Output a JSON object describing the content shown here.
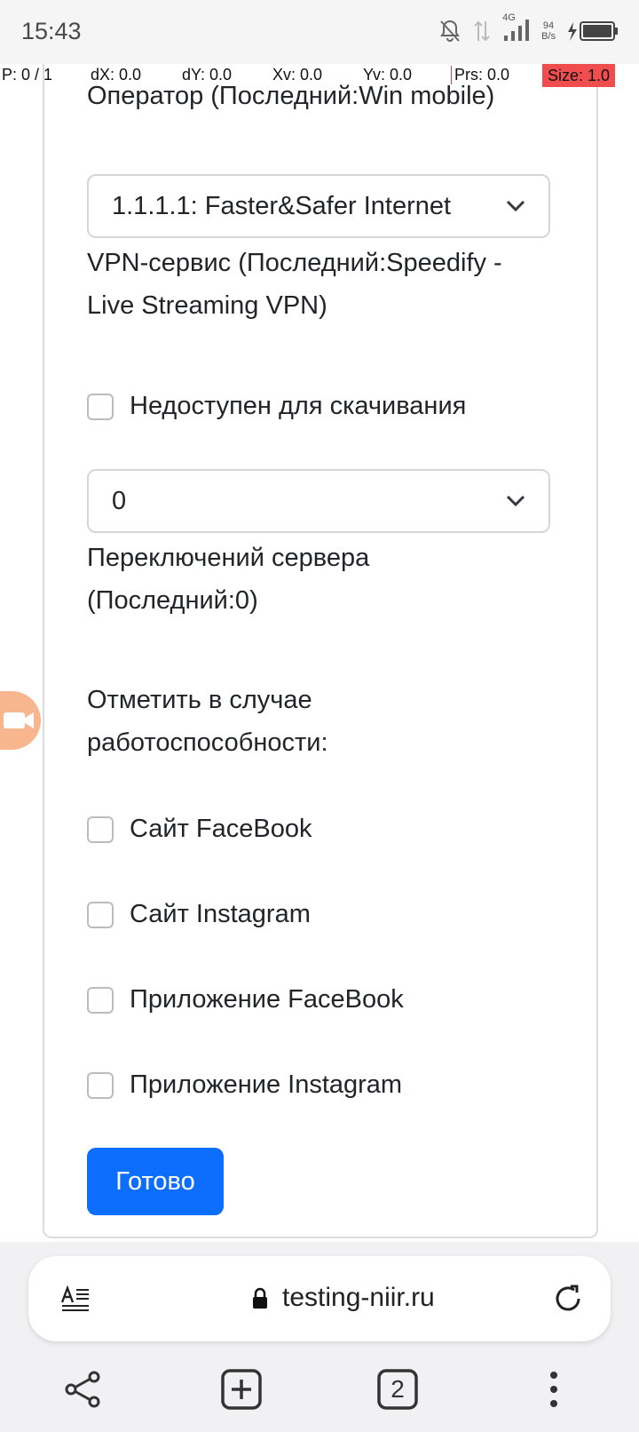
{
  "status_bar": {
    "time": "15:43",
    "network": "4G",
    "speed_value": "94",
    "speed_unit": "B/s"
  },
  "overlay": {
    "pointer": "P: 0 / 1",
    "dx": "dX: 0.0",
    "dy": "dY: 0.0",
    "xv": "Xv: 0.0",
    "yv": "Yv: 0.0",
    "prs": "Prs: 0.0",
    "size": "Size: 1.0"
  },
  "form": {
    "operator_label": "Оператор (Последний:Win mobile)",
    "vpn_select_value": "1.1.1.1: Faster&Safer Internet",
    "vpn_label_line1": "VPN-сервис (Последний:Speedify -",
    "vpn_label_line2": "Live Streaming VPN)",
    "unavailable_label": "Недоступен для скачивания",
    "switch_select_value": "0",
    "switch_label_line1": "Переключений сервера",
    "switch_label_line2": "(Последний:0)",
    "mark_label_line1": "Отметить в случае",
    "mark_label_line2": "работоспособности:",
    "checks": [
      {
        "label": "Сайт FaceBook"
      },
      {
        "label": "Сайт Instagram"
      },
      {
        "label": "Приложение FaceBook"
      },
      {
        "label": "Приложение Instagram"
      }
    ],
    "submit_label": "Готово"
  },
  "browser": {
    "url": "testing-niir.ru",
    "tab_count": "2"
  },
  "colors": {
    "primary": "#0d6efd",
    "overlay_size_bg": "#f04d4f",
    "bubble": "#f8b68f"
  }
}
